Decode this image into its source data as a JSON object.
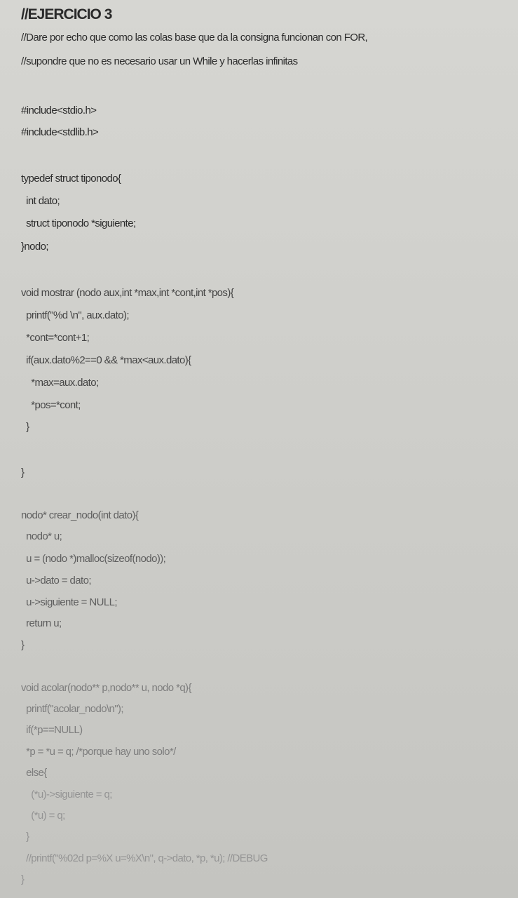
{
  "document": {
    "title": "//EJERCICIO 3",
    "comments": [
      "//Dare por echo que como las colas base que da la consigna funcionan con FOR,",
      "//supondre que no es necesario usar un While y hacerlas infinitas"
    ],
    "includes": [
      "#include<stdio.h>",
      "#include<stdlib.h>"
    ],
    "struct_block": [
      "typedef struct tiponodo{",
      "  int dato;",
      "  struct tiponodo *siguiente;",
      "}nodo;"
    ],
    "mostrar_block": [
      "void mostrar (nodo aux,int *max,int *cont,int *pos){",
      "  printf(\"%d \\n\", aux.dato);",
      "  *cont=*cont+1;",
      "  if(aux.dato%2==0 && *max<aux.dato){",
      "    *max=aux.dato;",
      "    *pos=*cont;",
      "  }",
      "}"
    ],
    "crear_block": [
      "nodo* crear_nodo(int dato){",
      "  nodo* u;",
      "  u = (nodo *)malloc(sizeof(nodo));",
      "  u->dato = dato;",
      "  u->siguiente = NULL;",
      "  return u;",
      "}"
    ],
    "acolar_block": [
      "void acolar(nodo** p,nodo** u, nodo *q){",
      "  printf(\"acolar_nodo\\n\");",
      "  if(*p==NULL)",
      "  *p = *u = q; /*porque hay uno solo*/",
      "  else{",
      "    (*u)->siguiente = q;",
      "    (*u) = q;",
      "  }",
      "  //printf(\"%02d p=%X u=%X\\n\", q->dato, *p, *u); //DEBUG",
      "}"
    ]
  }
}
